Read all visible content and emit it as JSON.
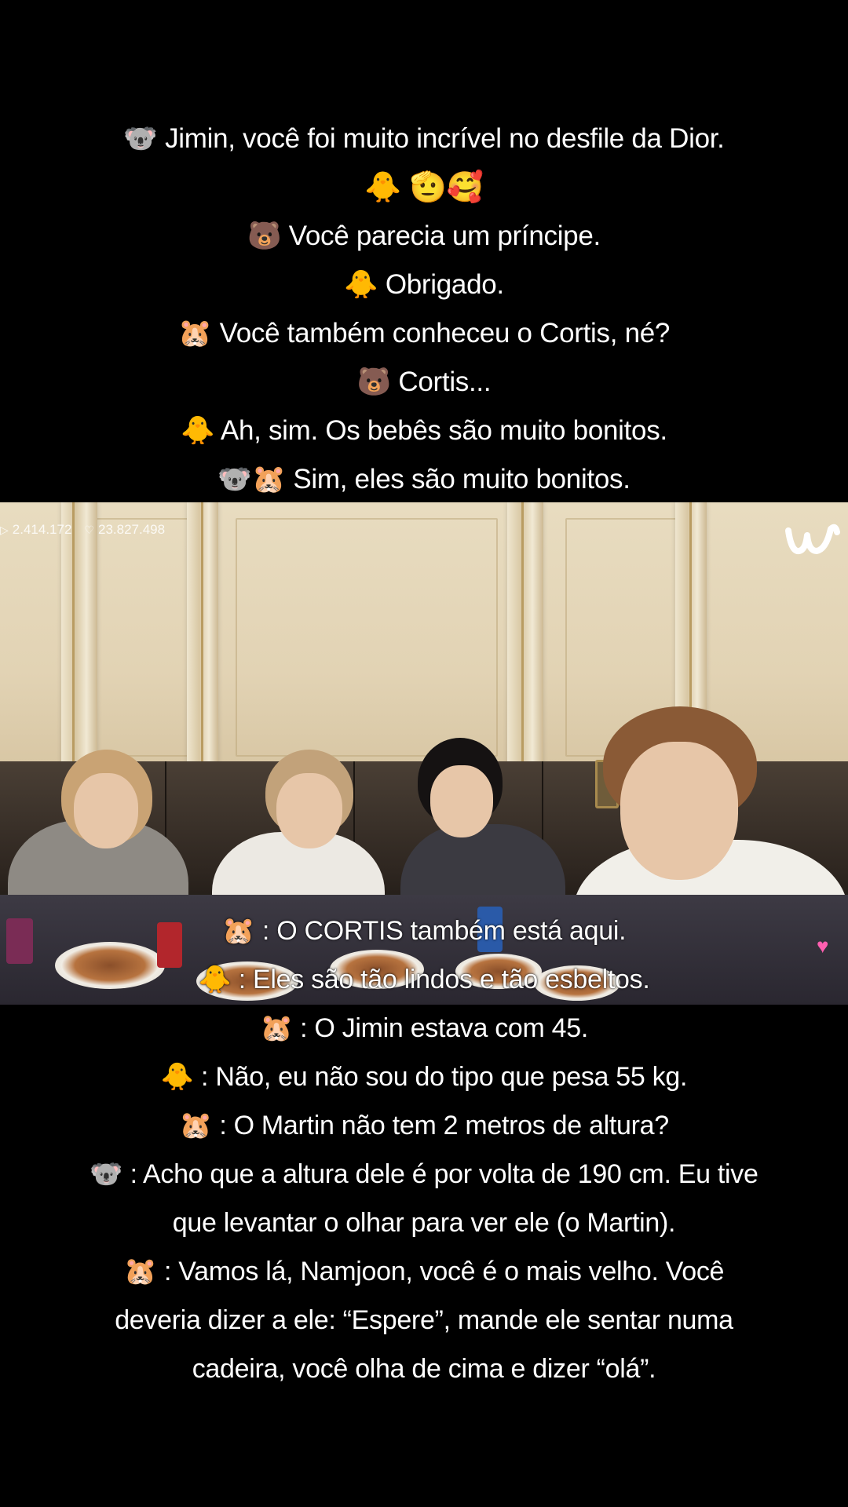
{
  "top_captions": [
    "🐨 Jimin, você foi muito incrível no desfile da Dior.",
    "🐥 🫡🥰",
    "🐻 Você parecia um príncipe.",
    "🐥 Obrigado.",
    "🐹 Você também conheceu o Cortis, né?",
    "🐻 Cortis...",
    "🐥 Ah, sim. Os bebês são muito bonitos.",
    "🐨🐹 Sim, eles são muito bonitos."
  ],
  "video": {
    "stats": {
      "plays": "2.414.172",
      "likes": "23.827.498",
      "play_icon": "play-icon",
      "heart_icon": "heart-icon"
    },
    "logo_icon": "weverse-logo-icon",
    "heart_badge_icon": "pink-heart-icon",
    "overlay_captions": [
      "🐹 : O CORTIS também está aqui.",
      "🐥 : Eles são tão lindos e tão esbeltos."
    ]
  },
  "bottom_captions": [
    "🐹 : O Jimin estava com 45.",
    "🐥 : Não, eu não sou do tipo que pesa 55 kg.",
    "🐹 : O Martin não tem 2 metros de altura?",
    "🐨 : Acho que a altura dele é por volta de 190 cm. Eu tive",
    "que levantar o olhar para ver ele (o Martin).",
    "🐹 : Vamos lá, Namjoon, você é o mais velho. Você",
    "deveria dizer a ele: “Espere”, mande ele sentar numa",
    "cadeira,  você olha de cima e dizer “olá”."
  ],
  "colors": {
    "background": "#000000",
    "text": "#ffffff",
    "heart_badge": "#ff5fb0"
  }
}
